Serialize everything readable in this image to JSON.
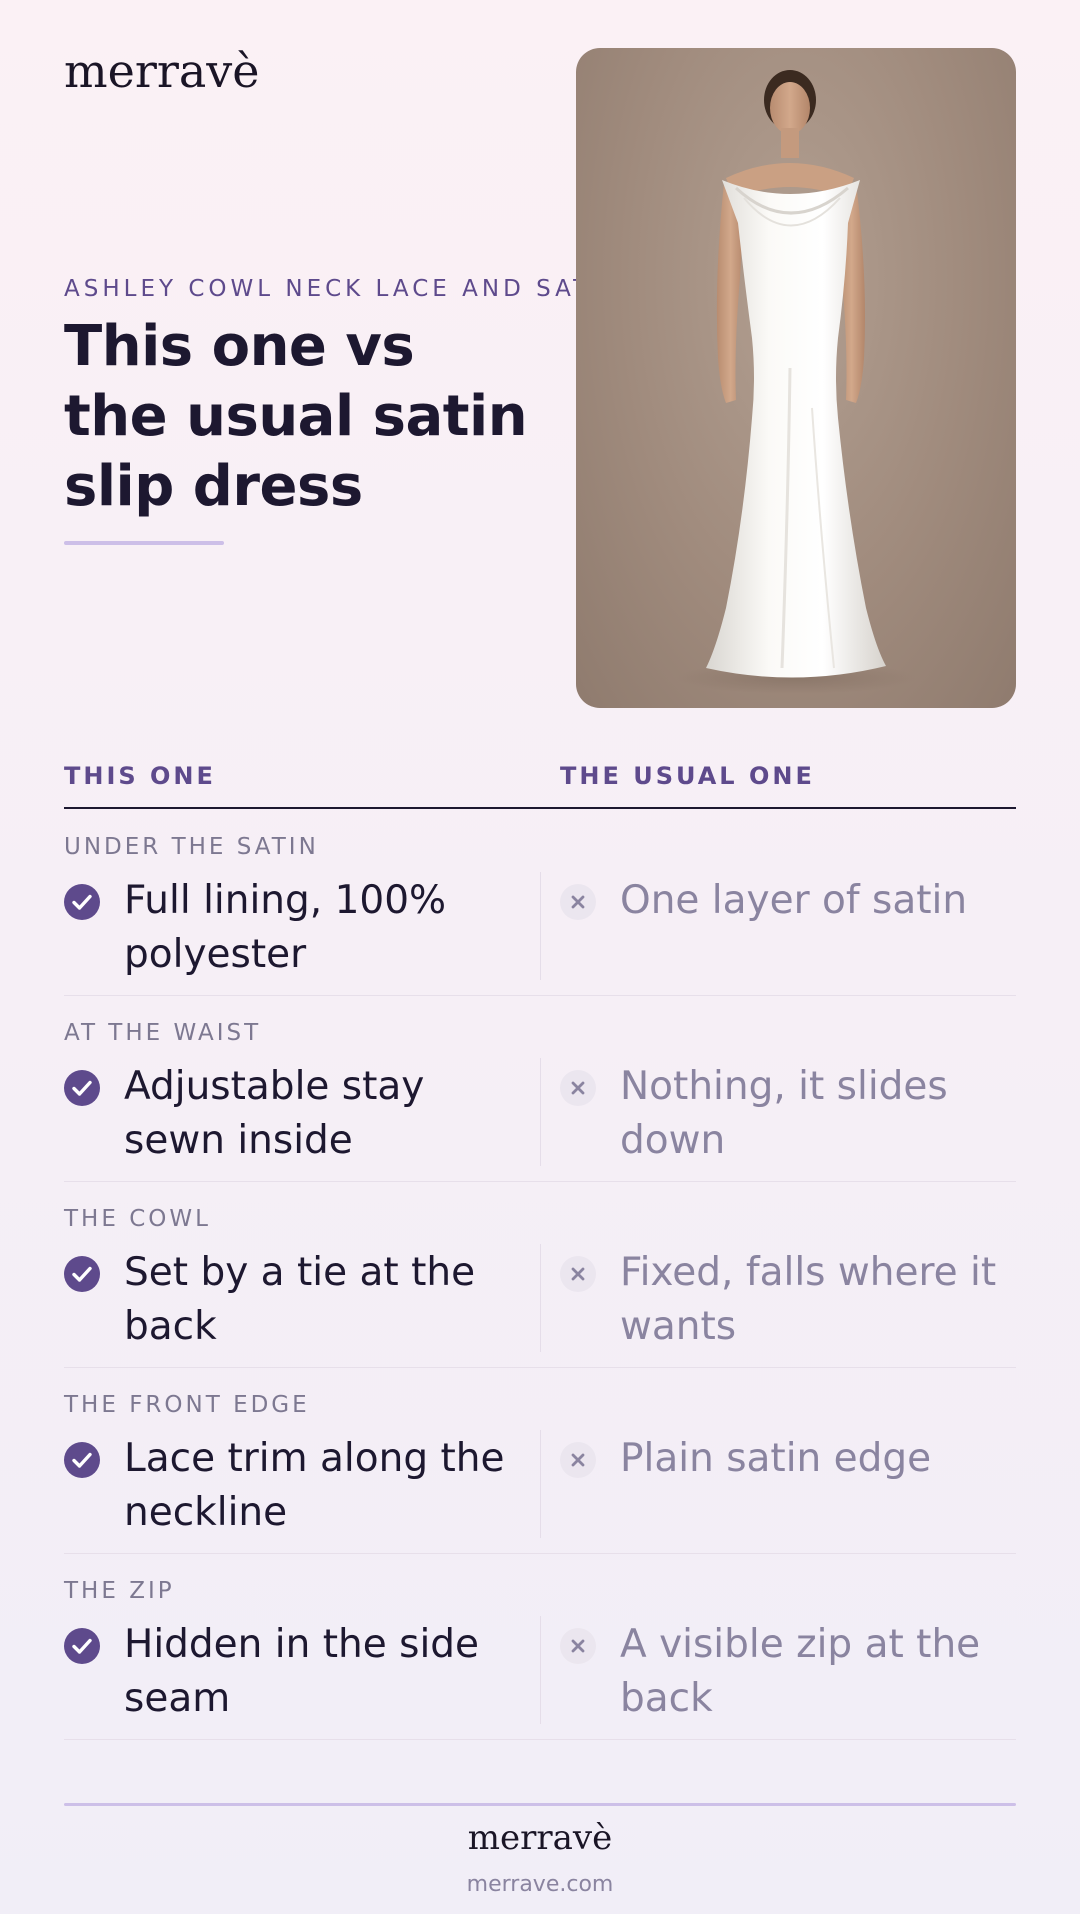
{
  "brand": {
    "logo": "merravè",
    "url": "merrave.com"
  },
  "hero": {
    "eyebrow": "ASHLEY COWL NECK LACE AND SATIN",
    "headline": "This one vs the usual satin slip dress",
    "image_alt": "Model wearing a white cowl neck satin slip gown"
  },
  "table": {
    "col_left": "THIS ONE",
    "col_right": "THE USUAL ONE",
    "rows": [
      {
        "label": "UNDER THE SATIN",
        "this_one": "Full lining, 100% polyester",
        "usual_one": "One layer of satin"
      },
      {
        "label": "AT THE WAIST",
        "this_one": "Adjustable stay sewn inside",
        "usual_one": "Nothing, it slides down"
      },
      {
        "label": "THE COWL",
        "this_one": "Set by a tie at the back",
        "usual_one": "Fixed, falls where it wants"
      },
      {
        "label": "THE FRONT EDGE",
        "this_one": "Lace trim along the neckline",
        "usual_one": "Plain satin edge"
      },
      {
        "label": "THE ZIP",
        "this_one": "Hidden in the side seam",
        "usual_one": "A visible zip at the back"
      }
    ]
  },
  "icons": {
    "positive": "check-circle-icon",
    "negative": "x-circle-icon"
  },
  "colors": {
    "accent": "#5e4a8c",
    "text": "#1d1830",
    "muted": "#8a84a0",
    "rule": "#cdbfe8"
  }
}
